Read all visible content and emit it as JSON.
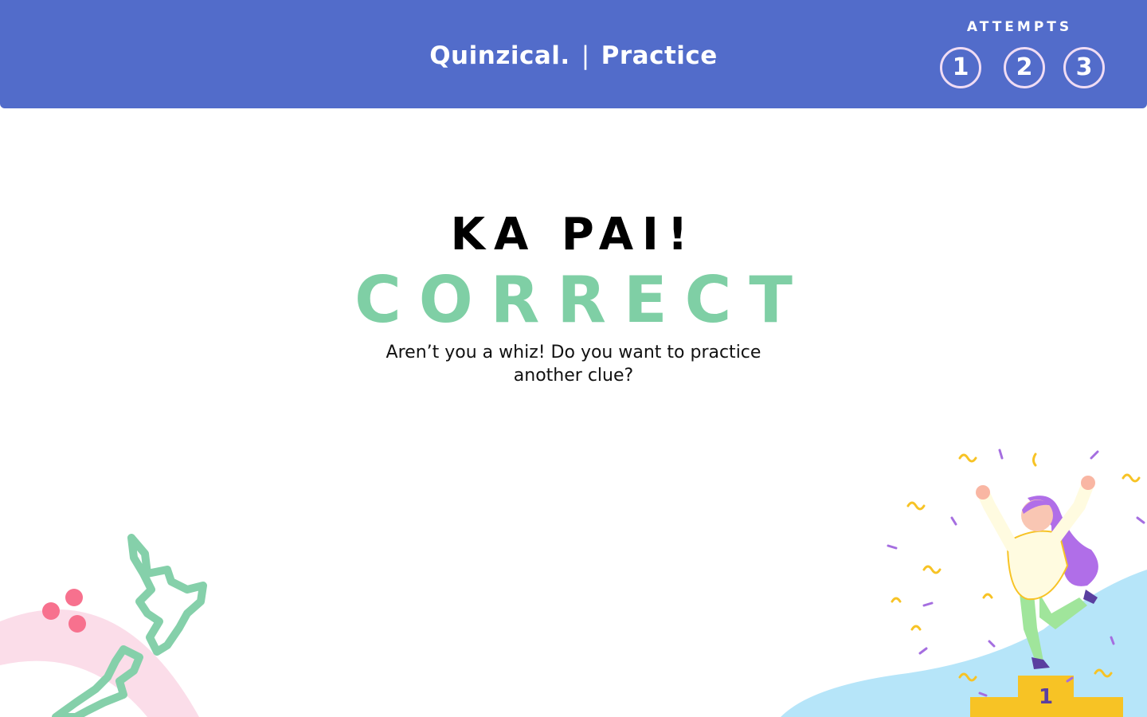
{
  "header": {
    "brand": "Quinzical.",
    "separator": "|",
    "mode": "Practice",
    "attempts_label": "ATTEMPTS",
    "attempts": [
      "1",
      "2",
      "3"
    ]
  },
  "result": {
    "title": "KA PAI!",
    "status": "CORRECT",
    "message": "Aren’t you a whiz! Do you want to practice another clue?"
  },
  "illustrations": {
    "left": "new-zealand-map-icon",
    "right": "celebrating-winner-on-podium",
    "podium_label": "1"
  },
  "colors": {
    "header_bg": "#526cca",
    "correct_green": "#7fcfa5",
    "attempt_ring": "#f0dcf4",
    "pink_dot": "#f7718e",
    "pink_arc": "#fbdde9",
    "sky_blue": "#b6e5f9",
    "podium_yellow": "#f7c325"
  }
}
